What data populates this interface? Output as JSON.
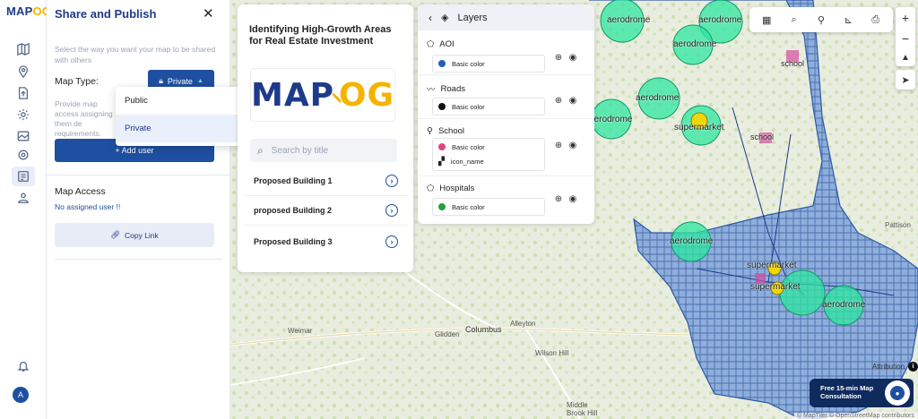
{
  "app": {
    "logo_main": "MAP",
    "logo_accent": "OG"
  },
  "rail": {
    "icons": [
      "map-icon",
      "location-pin-icon",
      "upload-icon",
      "settings-icon",
      "image-icon",
      "gear-icon",
      "share-icon",
      "bell-icon",
      "avatar"
    ],
    "avatar_initial": "A"
  },
  "share": {
    "title": "Share and Publish",
    "description": "Select the way you want your map to be shared with others",
    "map_type_label": "Map Type:",
    "private_label": "Private",
    "provide_text": "Provide map access assigning them de requirements.",
    "add_user_label": "+ Add user",
    "access_title": "Map Access",
    "no_user": "No assigned user !!",
    "copy_link_label": "Copy Link",
    "dropdown_options": [
      "Public",
      "Private"
    ],
    "dropdown_selected": "Private"
  },
  "story": {
    "title": "Identifying High-Growth Areas for Real Estate Investment",
    "logo_main": "MAP",
    "logo_accent": "OG",
    "search_placeholder": "Search by title",
    "items": [
      "Proposed Building 1",
      "proposed Building 2",
      "Proposed Building 3"
    ]
  },
  "layers": {
    "title": "Layers",
    "groups": [
      {
        "name": "AOI",
        "styles": [
          {
            "label": "Basic color",
            "color": "#1e5fbf"
          }
        ]
      },
      {
        "name": "Roads",
        "styles": [
          {
            "label": "Basic color",
            "color": "#111111"
          }
        ]
      },
      {
        "name": "School",
        "styles": [
          {
            "label": "Basic color",
            "color": "#e0457b"
          },
          {
            "label": "icon_name",
            "color": ""
          }
        ]
      },
      {
        "name": "Hospitals",
        "styles": [
          {
            "label": "Basic color",
            "color": "#22a33a"
          }
        ]
      }
    ]
  },
  "map": {
    "labels": {
      "columbus": "Columbus",
      "alleyton": "Alleyton",
      "glidden": "Glidden",
      "weimar": "Weimar",
      "pattison": "Pattison",
      "wilson_hill": "Wilson Hill",
      "middle_brook": "Middle Brook Hill"
    },
    "poi": {
      "aerodrome": "aerodrome",
      "supermarket": "supermarket",
      "school": "school"
    },
    "attribution_text": "Attribution",
    "attribution_footer": "© MapTiler © OpenStreetMap contributors",
    "consult_line1": "Free 15-min Map",
    "consult_line2": "Consultation",
    "colors": {
      "aoi": "#5b8fd6",
      "hospital": "#2ec28a",
      "school": "#d44aa0",
      "accent": "#1e4fa0"
    }
  }
}
